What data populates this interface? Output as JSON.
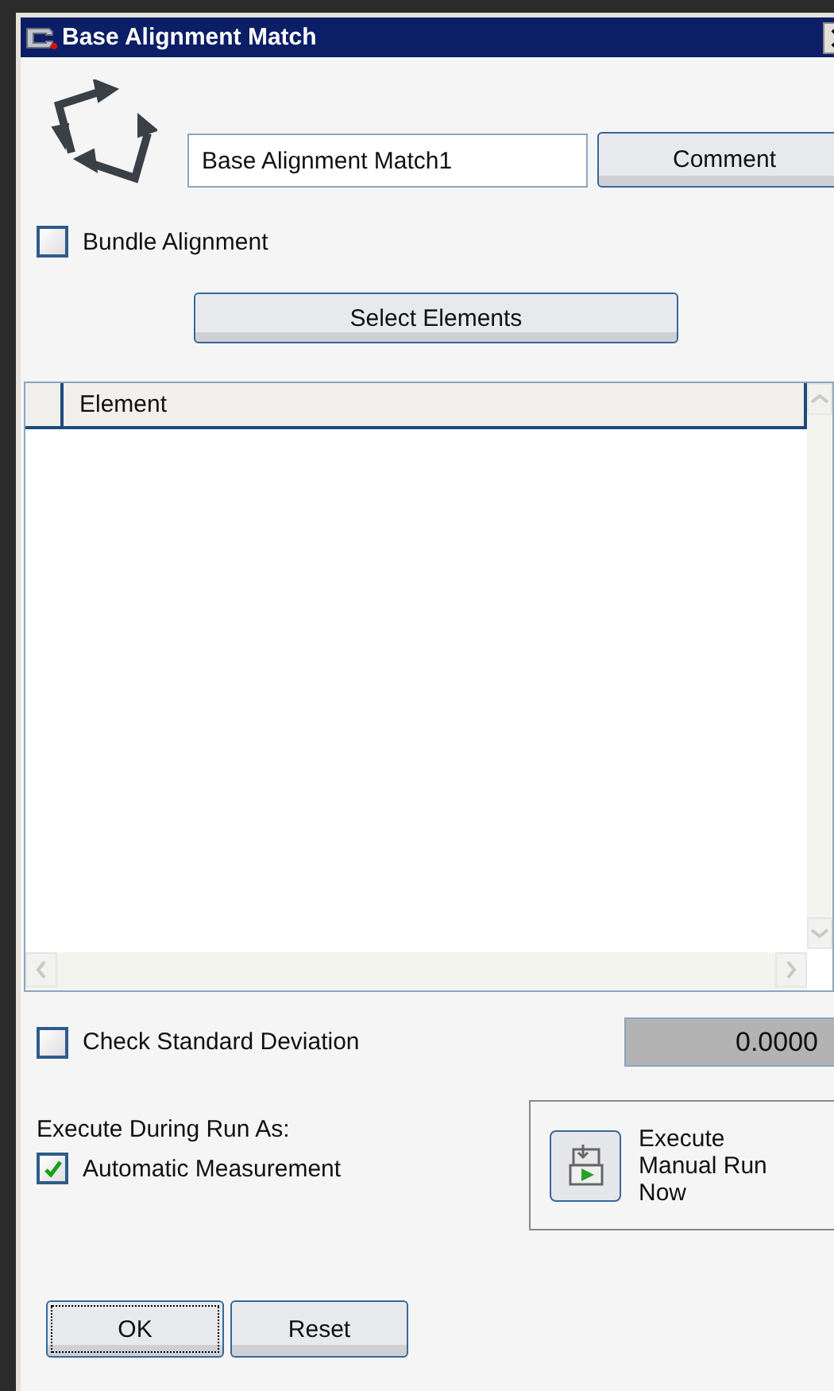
{
  "window": {
    "title": "Base Alignment Match"
  },
  "name_field": {
    "value": "Base Alignment Match1"
  },
  "comment_button": "Comment",
  "bundle_alignment": {
    "label": "Bundle Alignment",
    "checked": false
  },
  "select_button": "Select Elements",
  "table": {
    "columns": [
      "Element"
    ]
  },
  "std_dev": {
    "label": "Check Standard Deviation",
    "checked": false,
    "value": "0.0000"
  },
  "execute_section": {
    "label": "Execute During Run As:",
    "automatic": {
      "label": "Automatic Measurement",
      "checked": true
    }
  },
  "manual_run": {
    "label": "Execute Manual Run Now"
  },
  "buttons": [
    {
      "label": "OK",
      "focused": true
    },
    {
      "label": "Reset",
      "focused": false
    }
  ]
}
